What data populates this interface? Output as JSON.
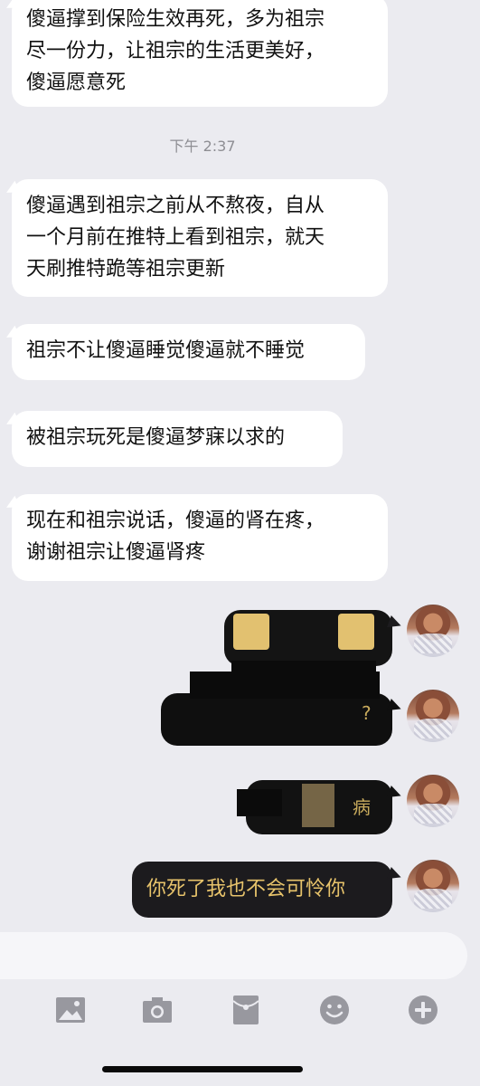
{
  "messages_incoming": [
    {
      "lines": [
        "傻逼撑到保险生效再死，多为祖宗",
        "尽一份力，让祖宗的生活更美好，",
        "傻逼愿意死"
      ]
    },
    {
      "lines": [
        "傻逼遇到祖宗之前从不熬夜，自从",
        "一个月前在推特上看到祖宗，就天",
        "天刷推特跪等祖宗更新"
      ]
    },
    {
      "lines": [
        "祖宗不让傻逼睡觉傻逼就不睡觉"
      ]
    },
    {
      "lines": [
        "被祖宗玩死是傻逼梦寐以求的"
      ]
    },
    {
      "lines": [
        "现在和祖宗说话，傻逼的肾在疼，",
        "谢谢祖宗让傻逼肾疼"
      ]
    }
  ],
  "timestamp": "下午 2:37",
  "outgoing": {
    "partial_1": "?",
    "partial_2": "病",
    "last": "你死了我也不会可怜你"
  },
  "toolbar": {
    "icons": [
      "image-icon",
      "camera-icon",
      "red-packet-icon",
      "emoji-icon",
      "plus-icon"
    ]
  },
  "colors": {
    "background": "#ebebf0",
    "incoming_bubble": "#ffffff",
    "outgoing_bubble": "#1c1b1e",
    "outgoing_text": "#e7c36b",
    "icon": "#98989f"
  }
}
